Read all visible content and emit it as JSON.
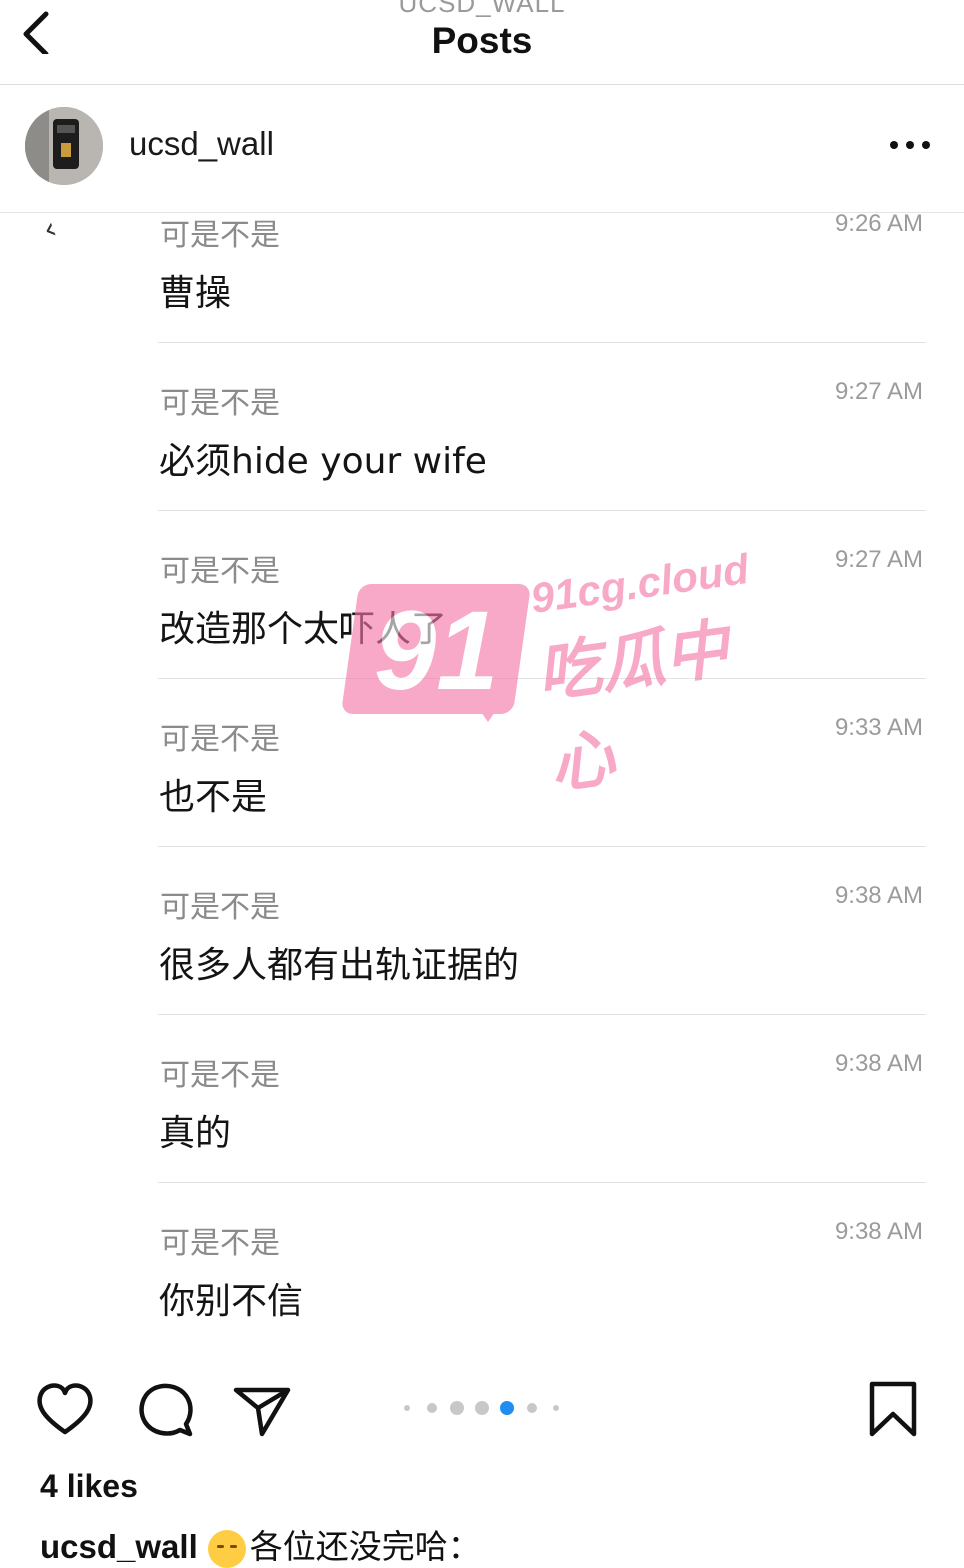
{
  "nav": {
    "account_sub": "UCSD_WALL",
    "title": "Posts"
  },
  "post": {
    "username": "ucsd_wall"
  },
  "messages": [
    {
      "sender": "可是不是",
      "time": "9:26 AM",
      "text": "曹操"
    },
    {
      "sender": "可是不是",
      "time": "9:27 AM",
      "text": "必须hide your wife"
    },
    {
      "sender": "可是不是",
      "time": "9:27 AM",
      "text": "改造那个太吓人了"
    },
    {
      "sender": "可是不是",
      "time": "9:33 AM",
      "text": "也不是"
    },
    {
      "sender": "可是不是",
      "time": "9:38 AM",
      "text": "很多人都有出轨证据的"
    },
    {
      "sender": "可是不是",
      "time": "9:38 AM",
      "text": "真的"
    },
    {
      "sender": "可是不是",
      "time": "9:38 AM",
      "text": "你别不信"
    }
  ],
  "watermark": {
    "number": "91",
    "domain": "91cg.cloud",
    "label": "吃瓜中心",
    "color": "#f576a6"
  },
  "carousel": {
    "total_dots": 7,
    "active_index": 4,
    "active_color": "#1f8ef1"
  },
  "footer": {
    "likes": "4 likes",
    "caption_user": "ucsd_wall",
    "caption_text": "各位还没完哈："
  },
  "icons": {
    "back": "chevron-left-icon",
    "more": "more-horizontal-icon",
    "like": "heart-icon",
    "comment": "comment-icon",
    "share": "send-icon",
    "save": "bookmark-icon"
  }
}
